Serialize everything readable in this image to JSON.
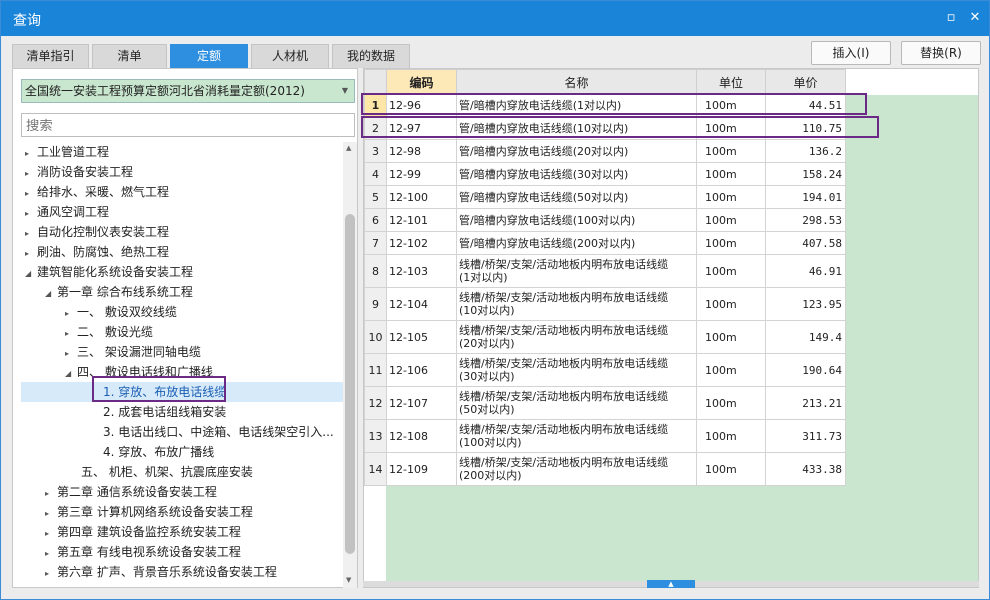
{
  "window": {
    "title": "查询"
  },
  "tabs": [
    {
      "label": "清单指引"
    },
    {
      "label": "清单"
    },
    {
      "label": "定额"
    },
    {
      "label": "人材机"
    },
    {
      "label": "我的数据"
    }
  ],
  "buttons": {
    "insert": "插入(I)",
    "replace": "替换(R)"
  },
  "left": {
    "combo_value": "全国统一安装工程预算定额河北省消耗量定额(2012)",
    "search_placeholder": "搜索",
    "tree": [
      {
        "label": "工业管道工程",
        "expanded": false
      },
      {
        "label": "消防设备安装工程",
        "expanded": false
      },
      {
        "label": "给排水、采暖、燃气工程",
        "expanded": false
      },
      {
        "label": "通风空调工程",
        "expanded": false
      },
      {
        "label": "自动化控制仪表安装工程",
        "expanded": false
      },
      {
        "label": "刷油、防腐蚀、绝热工程",
        "expanded": false
      },
      {
        "label": "建筑智能化系统设备安装工程",
        "expanded": true
      },
      {
        "label": "第一章 综合布线系统工程",
        "expanded": true
      },
      {
        "label": "一、 敷设双绞线缆",
        "expanded": false
      },
      {
        "label": "二、 敷设光缆",
        "expanded": false
      },
      {
        "label": "三、 架设漏泄同轴电缆",
        "expanded": false
      },
      {
        "label": "四、 敷设电话线和广播线",
        "expanded": true
      },
      {
        "label": "1. 穿放、布放电话线缆",
        "selected": true
      },
      {
        "label": "2. 成套电话组线箱安装"
      },
      {
        "label": "3. 电话出线口、中途箱、电话线架空引入..."
      },
      {
        "label": "4. 穿放、布放广播线"
      },
      {
        "label": "五、 机柜、机架、抗震底座安装"
      },
      {
        "label": "第二章 通信系统设备安装工程",
        "expanded": false
      },
      {
        "label": "第三章 计算机网络系统设备安装工程",
        "expanded": false
      },
      {
        "label": "第四章 建筑设备监控系统安装工程",
        "expanded": false
      },
      {
        "label": "第五章 有线电视系统设备安装工程",
        "expanded": false
      },
      {
        "label": "第六章 扩声、背景音乐系统设备安装工程",
        "expanded": false
      }
    ]
  },
  "table": {
    "headers": {
      "code": "编码",
      "name": "名称",
      "unit": "单位",
      "price": "单价"
    },
    "rows": [
      {
        "n": "1",
        "code": "12-96",
        "name": [
          "管/暗槽内穿放电话线缆(1对以内)"
        ],
        "unit": "100m",
        "price": "44.51"
      },
      {
        "n": "2",
        "code": "12-97",
        "name": [
          "管/暗槽内穿放电话线缆(10对以内)"
        ],
        "unit": "100m",
        "price": "110.75"
      },
      {
        "n": "3",
        "code": "12-98",
        "name": [
          "管/暗槽内穿放电话线缆(20对以内)"
        ],
        "unit": "100m",
        "price": "136.2"
      },
      {
        "n": "4",
        "code": "12-99",
        "name": [
          "管/暗槽内穿放电话线缆(30对以内)"
        ],
        "unit": "100m",
        "price": "158.24"
      },
      {
        "n": "5",
        "code": "12-100",
        "name": [
          "管/暗槽内穿放电话线缆(50对以内)"
        ],
        "unit": "100m",
        "price": "194.01"
      },
      {
        "n": "6",
        "code": "12-101",
        "name": [
          "管/暗槽内穿放电话线缆(100对以内)"
        ],
        "unit": "100m",
        "price": "298.53"
      },
      {
        "n": "7",
        "code": "12-102",
        "name": [
          "管/暗槽内穿放电话线缆(200对以内)"
        ],
        "unit": "100m",
        "price": "407.58"
      },
      {
        "n": "8",
        "code": "12-103",
        "name": [
          "线槽/桥架/支架/活动地板内明布放电话线缆",
          "(1对以内)"
        ],
        "unit": "100m",
        "price": "46.91"
      },
      {
        "n": "9",
        "code": "12-104",
        "name": [
          "线槽/桥架/支架/活动地板内明布放电话线缆",
          "(10对以内)"
        ],
        "unit": "100m",
        "price": "123.95"
      },
      {
        "n": "10",
        "code": "12-105",
        "name": [
          "线槽/桥架/支架/活动地板内明布放电话线缆",
          "(20对以内)"
        ],
        "unit": "100m",
        "price": "149.4"
      },
      {
        "n": "11",
        "code": "12-106",
        "name": [
          "线槽/桥架/支架/活动地板内明布放电话线缆",
          "(30对以内)"
        ],
        "unit": "100m",
        "price": "190.64"
      },
      {
        "n": "12",
        "code": "12-107",
        "name": [
          "线槽/桥架/支架/活动地板内明布放电话线缆",
          "(50对以内)"
        ],
        "unit": "100m",
        "price": "213.21"
      },
      {
        "n": "13",
        "code": "12-108",
        "name": [
          "线槽/桥架/支架/活动地板内明布放电话线缆",
          "(100对以内)"
        ],
        "unit": "100m",
        "price": "311.73"
      },
      {
        "n": "14",
        "code": "12-109",
        "name": [
          "线槽/桥架/支架/活动地板内明布放电话线缆",
          "(200对以内)"
        ],
        "unit": "100m",
        "price": "433.38"
      }
    ]
  },
  "colors": {
    "titlebar": "#1a84d8",
    "active_tab": "#2e8fe0",
    "highlight_border": "#6b2a86",
    "grid_fill": "#cbe6cf"
  }
}
